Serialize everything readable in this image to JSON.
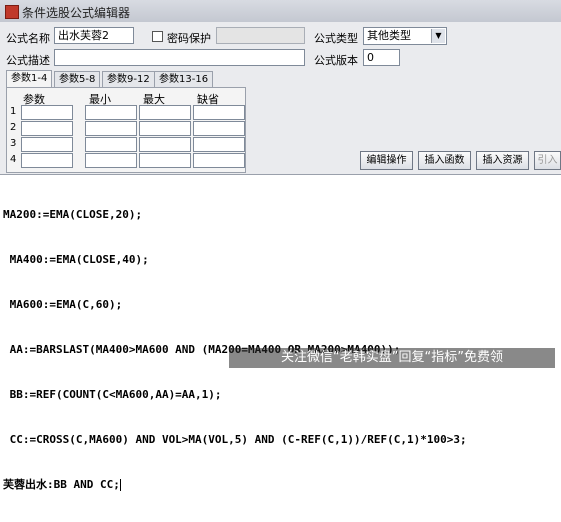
{
  "window": {
    "title": "条件选股公式编辑器"
  },
  "form": {
    "name_label": "公式名称",
    "name_value": "出水芙蓉2",
    "password_label": "密码保护",
    "password_value": "",
    "type_label": "公式类型",
    "type_value": "其他类型",
    "desc_label": "公式描述",
    "desc_value": "",
    "version_label": "公式版本",
    "version_value": "0"
  },
  "tabs": [
    "参数1-4",
    "参数5-8",
    "参数9-12",
    "参数13-16"
  ],
  "params": {
    "headers": [
      "参数",
      "最小",
      "最大",
      "缺省"
    ],
    "rows": [
      "1",
      "2",
      "3",
      "4"
    ]
  },
  "buttons": {
    "edit_ops": "编辑操作",
    "insert_func": "插入函数",
    "insert_res": "插入资源",
    "import": "引入"
  },
  "code": [
    "MA200:=EMA(CLOSE,20);",
    " MA400:=EMA(CLOSE,40);",
    " MA600:=EMA(C,60);",
    " AA:=BARSLAST(MA400>MA600 AND (MA200=MA400 OR MA200>MA400));",
    " BB:=REF(COUNT(C<MA600,AA)=AA,1);",
    " CC:=CROSS(C,MA600) AND VOL>MA(VOL,5) AND (C-REF(C,1))/REF(C,1)*100>3;",
    "芙蓉出水:BB AND CC;"
  ],
  "watermark": "关注微信“老韩实盘”回复“指标”免费领"
}
